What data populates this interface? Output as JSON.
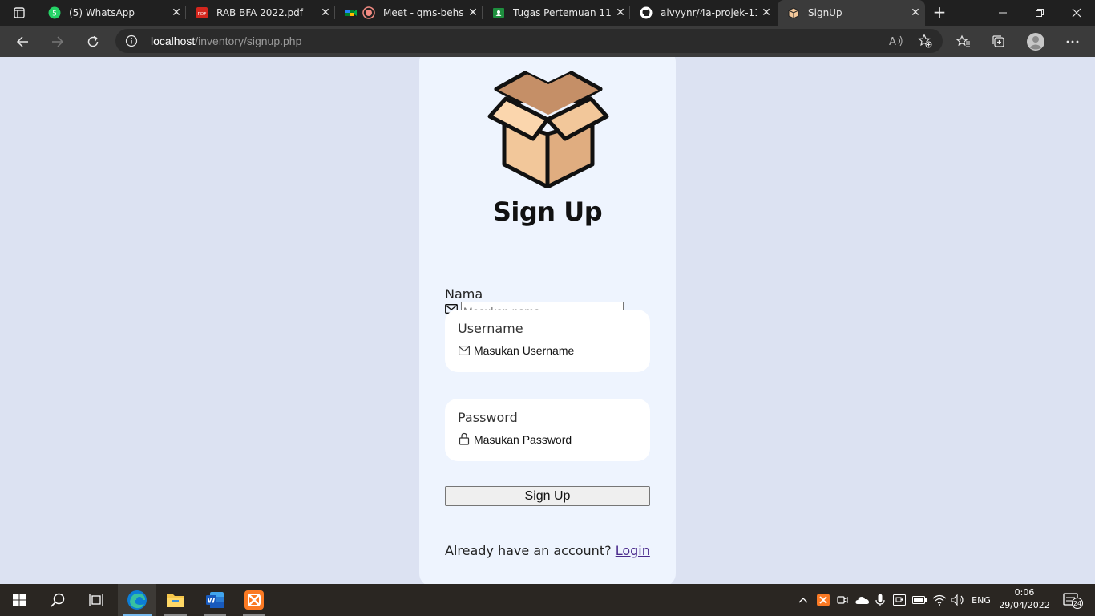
{
  "browser": {
    "tabs": [
      {
        "title": "(5) WhatsApp",
        "icon": "whatsapp-icon"
      },
      {
        "title": "RAB BFA 2022.pdf",
        "icon": "pdf-icon"
      },
      {
        "title": "Meet - qms-behs",
        "icon": "google-meet-icon"
      },
      {
        "title": "Tugas Pertemuan 11 (",
        "icon": "google-classroom-icon"
      },
      {
        "title": "alvyynr/4a-projek-11-",
        "icon": "github-icon"
      },
      {
        "title": "SignUp",
        "icon": "box-favicon-icon"
      }
    ],
    "active_tab": 5,
    "url_host": "localhost",
    "url_path": "/inventory/signup.php"
  },
  "page": {
    "title": "Sign Up",
    "nama_label": "Nama",
    "nama_placeholder": "Masukan nama",
    "username_label": "Username",
    "username_placeholder": "Masukan Username",
    "password_label": "Password",
    "password_placeholder": "Masukan Password",
    "signup_button": "Sign Up",
    "login_prompt": "Already have an account?",
    "login_link": "Login"
  },
  "taskbar": {
    "apps": [
      "start-icon",
      "search-icon",
      "task-view-icon",
      "edge-icon",
      "file-explorer-icon",
      "word-icon",
      "xampp-icon"
    ],
    "language": "ENG",
    "time": "0:06",
    "date": "29/04/2022",
    "notification_count": "24"
  },
  "colors": {
    "page_bg": "#dce2f2",
    "card_bg": "#eef4fe",
    "link": "#4a2a8c",
    "box_light": "#f2c79a",
    "box_dark": "#c58f67"
  }
}
